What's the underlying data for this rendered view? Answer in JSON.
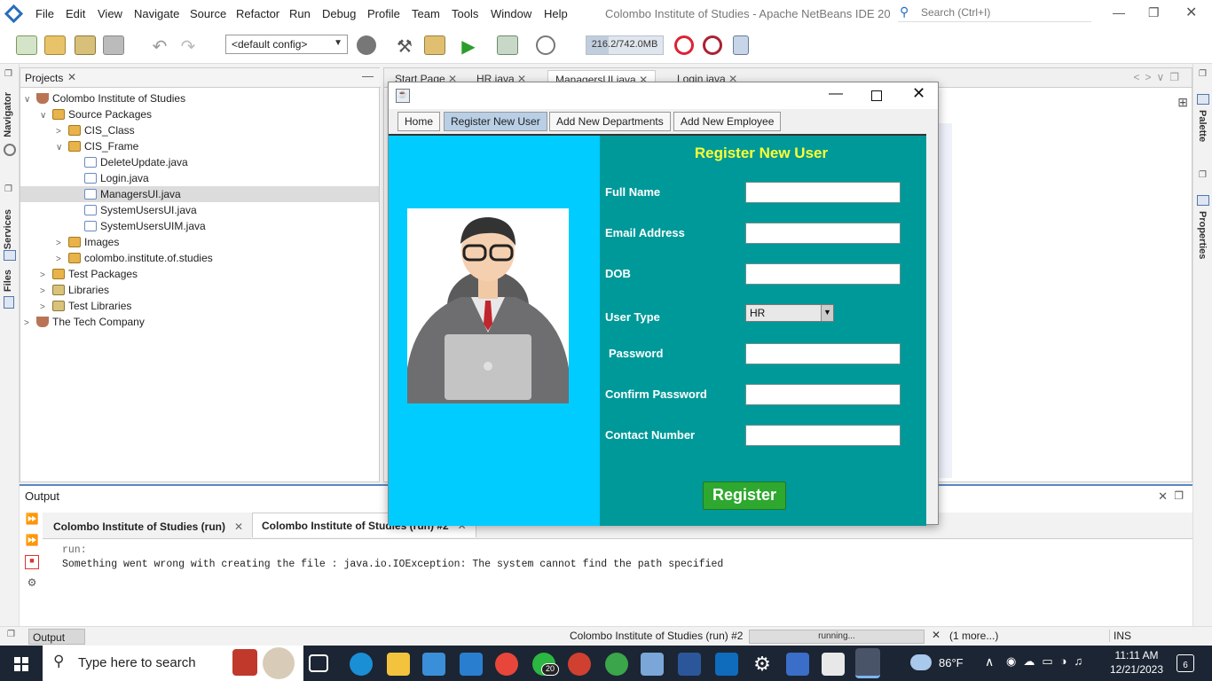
{
  "menubar": {
    "items": [
      "File",
      "Edit",
      "View",
      "Navigate",
      "Source",
      "Refactor",
      "Run",
      "Debug",
      "Profile",
      "Team",
      "Tools",
      "Window",
      "Help"
    ],
    "ide_title": "Colombo Institute of Studies - Apache NetBeans IDE 20",
    "search_placeholder": "Search (Ctrl+I)"
  },
  "toolbar": {
    "config": "<default config>",
    "memory": "216.2/742.0MB",
    "memory_fraction": 0.29
  },
  "left_strip": {
    "navigator": "Navigator",
    "services": "Services",
    "files": "Files"
  },
  "right_strip": {
    "palette": "Palette",
    "properties": "Properties"
  },
  "projects": {
    "tab_label": "Projects",
    "tree": [
      {
        "label": "Colombo Institute of Studies",
        "icon": "coffee-cup-icon"
      },
      {
        "label": "Source Packages",
        "icon": "package-folder-icon"
      },
      {
        "label": "CIS_Class",
        "icon": "package-icon"
      },
      {
        "label": "CIS_Frame",
        "icon": "package-icon"
      },
      {
        "label": "DeleteUpdate.java",
        "icon": "java-file-icon"
      },
      {
        "label": "Login.java",
        "icon": "java-file-icon"
      },
      {
        "label": "ManagersUI.java",
        "icon": "java-file-icon"
      },
      {
        "label": "SystemUsersUI.java",
        "icon": "java-file-icon"
      },
      {
        "label": "SystemUsersUIM.java",
        "icon": "java-file-icon"
      },
      {
        "label": "Images",
        "icon": "package-icon"
      },
      {
        "label": "colombo.institute.of.studies",
        "icon": "package-icon"
      },
      {
        "label": "Test Packages",
        "icon": "package-folder-icon"
      },
      {
        "label": "Libraries",
        "icon": "library-icon"
      },
      {
        "label": "Test Libraries",
        "icon": "library-icon"
      },
      {
        "label": "The Tech Company",
        "icon": "coffee-cup-icon"
      }
    ]
  },
  "editor": {
    "tabs": [
      "Start Page",
      "HR.java",
      "ManagersUI.java",
      "Login.java"
    ]
  },
  "output": {
    "title": "Output",
    "tabs": [
      "Colombo Institute of Studies (run)",
      "Colombo Institute of Studies (run) #2"
    ],
    "lines": [
      "run:",
      "Something went wrong with creating the file : java.io.IOException: The system cannot find the path specified"
    ]
  },
  "statusbar": {
    "output_label": "Output",
    "run_label": "Colombo Institute of Studies (run) #2",
    "progress_text": "running...",
    "more": "(1 more...)",
    "ins": "INS"
  },
  "taskbar": {
    "search_placeholder": "Type here to search",
    "weather": "86°F",
    "time": "11:11 AM",
    "date": "12/21/2023",
    "notifications": "6",
    "whatsapp_badge": "20"
  },
  "app_window": {
    "tabs": [
      "Home",
      "Register New User",
      "Add New Departments",
      "Add New Employee"
    ],
    "form_title": "Register New User",
    "fields": {
      "full_name": "Full Name",
      "email": "Email Address",
      "dob": "DOB",
      "user_type": "User Type",
      "password": "Password",
      "confirm_password": "Confirm Password",
      "contact": "Contact Number"
    },
    "user_type_value": "HR",
    "register_label": "Register",
    "colors": {
      "left_panel": "#00ccff",
      "form_panel": "#009999",
      "title": "#ffff33",
      "button": "#2ea82e"
    }
  }
}
